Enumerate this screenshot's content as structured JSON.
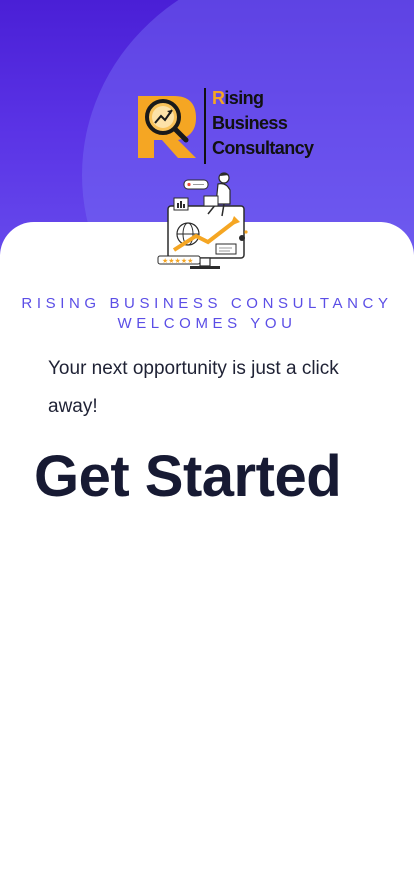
{
  "logo": {
    "lines": [
      "Rising",
      "Business",
      "Consultancy"
    ],
    "first_letter_color": "#f5a623",
    "mark_letter": "R",
    "mark_color": "#f5a623"
  },
  "illustration": {
    "icon": "analytics-illustration-icon"
  },
  "welcome": {
    "line1": "RISING BUSINESS CONSULTANCY",
    "line2": "WELCOMES YOU"
  },
  "subtitle": "Your next opportunity is just a click away!",
  "cta_label": "Get Started",
  "colors": {
    "hero_top": "#4a1fd6",
    "hero_bottom": "#6a52ee",
    "accent_text": "#5b4ee6",
    "heading": "#171a33"
  }
}
